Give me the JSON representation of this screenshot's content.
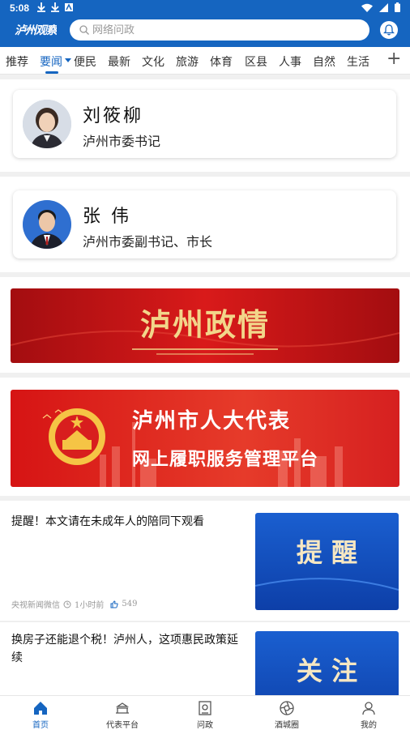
{
  "status_bar": {
    "time": "5:08"
  },
  "header": {
    "logo_text": "泸州观察",
    "search_placeholder": "网络问政"
  },
  "tabs": [
    {
      "label": "推荐"
    },
    {
      "label": "要闻"
    },
    {
      "label": "便民"
    },
    {
      "label": "最新"
    },
    {
      "label": "文化"
    },
    {
      "label": "旅游"
    },
    {
      "label": "体育"
    },
    {
      "label": "区县"
    },
    {
      "label": "人事"
    },
    {
      "label": "自然"
    },
    {
      "label": "生活"
    }
  ],
  "leaders": [
    {
      "name": "刘筱柳",
      "title": "泸州市委书记"
    },
    {
      "name": "张 伟",
      "title": "泸州市委副书记、市长"
    }
  ],
  "banners": {
    "zhengqing": "泸州政情",
    "renda_line1": "泸州市人大代表",
    "renda_line2": "网上履职服务管理平台"
  },
  "news": [
    {
      "title": "提醒！本文请在未成年人的陪同下观看",
      "source": "央视新闻微信",
      "time": "1小时前",
      "likes": "549",
      "thumb_text": "提 醒"
    },
    {
      "title": "换房子还能退个税！泸州人，这项惠民政策延续",
      "thumb_text": "关 注"
    }
  ],
  "bottom_nav": [
    {
      "label": "首页"
    },
    {
      "label": "代表平台"
    },
    {
      "label": "问政"
    },
    {
      "label": "酒城圈"
    },
    {
      "label": "我的"
    }
  ],
  "colors": {
    "primary": "#1565c0",
    "banner_red": "#c8102e",
    "gold": "#f2d68a"
  }
}
